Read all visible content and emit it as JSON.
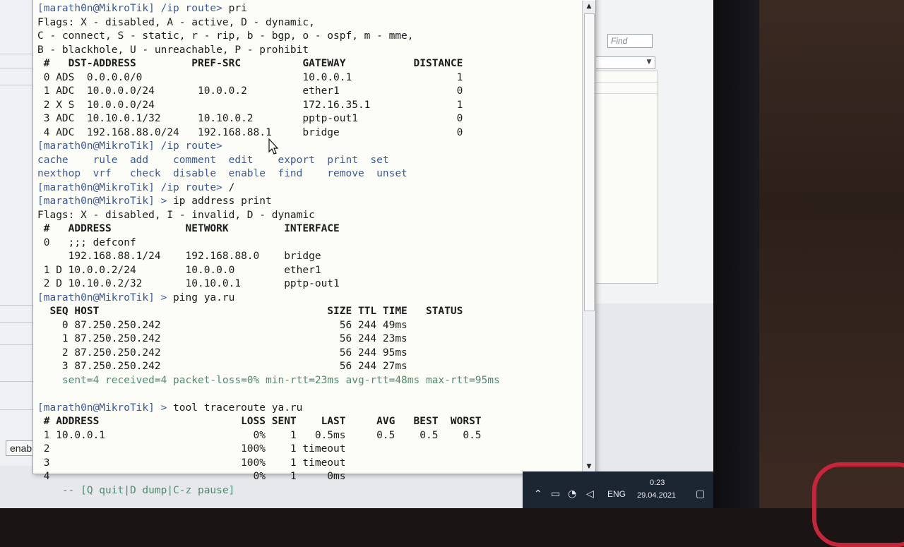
{
  "find": {
    "placeholder": "Find"
  },
  "status": {
    "enabled_label": "enabled"
  },
  "taskbar": {
    "language": "ENG",
    "time": "0:23",
    "date": "29.04.2021"
  },
  "terminal": {
    "lines": [
      "[marath0n@MikroTik] /ip route> pri",
      "Flags: X - disabled, A - active, D - dynamic,",
      "C - connect, S - static, r - rip, b - bgp, o - ospf, m - mme,",
      "B - blackhole, U - unreachable, P - prohibit",
      " #   DST-ADDRESS         PREF-SRC          GATEWAY           DISTANCE",
      " 0 ADS  0.0.0.0/0                          10.0.0.1                 1",
      " 1 ADC  10.0.0.0/24       10.0.0.2         ether1                   0",
      " 2 X S  10.0.0.0/24                        172.16.35.1              1",
      " 3 ADC  10.10.0.1/32      10.10.0.2        pptp-out1                0",
      " 4 ADC  192.168.88.0/24   192.168.88.1     bridge                   0",
      "[marath0n@MikroTik] /ip route>",
      "cache    rule  add    comment  edit    export  print  set",
      "nexthop  vrf   check  disable  enable  find    remove  unset",
      "[marath0n@MikroTik] /ip route> /",
      "[marath0n@MikroTik] > ip address print",
      "Flags: X - disabled, I - invalid, D - dynamic",
      " #   ADDRESS            NETWORK         INTERFACE",
      " 0   ;;; defconf",
      "     192.168.88.1/24    192.168.88.0    bridge",
      " 1 D 10.0.0.2/24        10.0.0.0        ether1",
      " 2 D 10.10.0.2/32       10.10.0.1       pptp-out1",
      "[marath0n@MikroTik] > ping ya.ru",
      "  SEQ HOST                                     SIZE TTL TIME   STATUS",
      "    0 87.250.250.242                             56 244 49ms",
      "    1 87.250.250.242                             56 244 23ms",
      "    2 87.250.250.242                             56 244 95ms",
      "    3 87.250.250.242                             56 244 27ms",
      "    sent=4 received=4 packet-loss=0% min-rtt=23ms avg-rtt=48ms max-rtt=95ms",
      "",
      "[marath0n@MikroTik] > tool traceroute ya.ru",
      " # ADDRESS                       LOSS SENT    LAST     AVG   BEST  WORST",
      " 1 10.0.0.1                        0%    1   0.5ms     0.5    0.5    0.5",
      " 2                               100%    1 timeout",
      " 3                               100%    1 timeout",
      " 4                                 0%    1     0ms",
      "    -- [Q quit|D dump|C-z pause]"
    ]
  }
}
